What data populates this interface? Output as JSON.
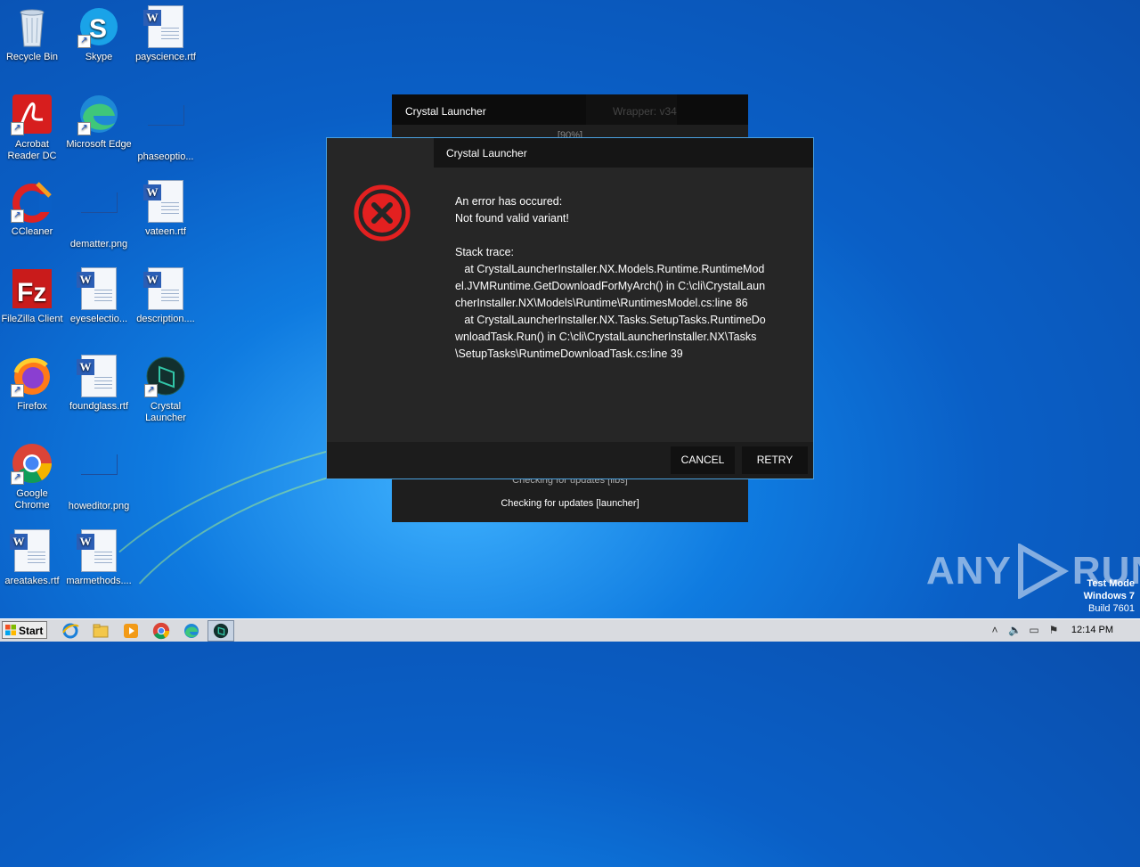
{
  "desktop": {
    "icons": [
      {
        "label": "Recycle Bin",
        "icon": "recycle-bin-icon"
      },
      {
        "label": "Skype",
        "icon": "skype-icon"
      },
      {
        "label": "payscience.rtf",
        "icon": "word-doc-icon"
      },
      {
        "label": "Acrobat Reader DC",
        "icon": "acrobat-icon"
      },
      {
        "label": "Microsoft Edge",
        "icon": "edge-icon"
      },
      {
        "label": "phaseoptio...",
        "icon": "png-file-icon"
      },
      {
        "label": "CCleaner",
        "icon": "ccleaner-icon"
      },
      {
        "label": "dematter.png",
        "icon": "png-file-icon"
      },
      {
        "label": "vateen.rtf",
        "icon": "word-doc-icon"
      },
      {
        "label": "FileZilla Client",
        "icon": "filezilla-icon"
      },
      {
        "label": "eyeselectio...",
        "icon": "word-doc-icon"
      },
      {
        "label": "description....",
        "icon": "word-doc-icon"
      },
      {
        "label": "Firefox",
        "icon": "firefox-icon"
      },
      {
        "label": "foundglass.rtf",
        "icon": "word-doc-icon"
      },
      {
        "label": "Crystal Launcher",
        "icon": "crystal-launcher-icon"
      },
      {
        "label": "Google Chrome",
        "icon": "chrome-icon"
      },
      {
        "label": "howeditor.png",
        "icon": "png-file-icon"
      },
      {
        "label": "areatakes.rtf",
        "icon": "word-doc-icon"
      },
      {
        "label": "marmethods....",
        "icon": "word-doc-icon"
      }
    ]
  },
  "launcher": {
    "title": "Crystal Launcher",
    "wrapper_label": "Wrapper: v34",
    "status_top": "[90%]",
    "status_libs": "Checking for updates [libs]",
    "status_launcher": "Checking for updates [launcher]"
  },
  "dialog": {
    "title": "Crystal Launcher",
    "icon": "error-x-icon",
    "message": "An error has occured:\nNot found valid variant!\n\nStack trace:\n   at CrystalLauncherInstaller.NX.Models.Runtime.RuntimeModel.JVMRuntime.GetDownloadForMyArch() in C:\\cli\\CrystalLauncherInstaller.NX\\Models\\Runtime\\RuntimesModel.cs:line 86\n   at CrystalLauncherInstaller.NX.Tasks.SetupTasks.RuntimeDownloadTask.Run() in C:\\cli\\CrystalLauncherInstaller.NX\\Tasks\\SetupTasks\\RuntimeDownloadTask.cs:line 39",
    "cancel_label": "CANCEL",
    "retry_label": "RETRY"
  },
  "watermark": {
    "brand_left": "ANY",
    "brand_right": "RUN",
    "line1": "Test Mode",
    "line2": "Windows 7",
    "line3": "Build 7601"
  },
  "taskbar": {
    "start_label": "Start",
    "clock": "12:14 PM",
    "pinned": [
      "ie-icon",
      "explorer-icon",
      "media-player-icon",
      "chrome-icon",
      "edge-icon",
      "crystal-launcher-icon"
    ]
  },
  "colors": {
    "dialog_border": "#4aa1e0",
    "error_red": "#e32020",
    "dialog_bg": "#262626"
  }
}
